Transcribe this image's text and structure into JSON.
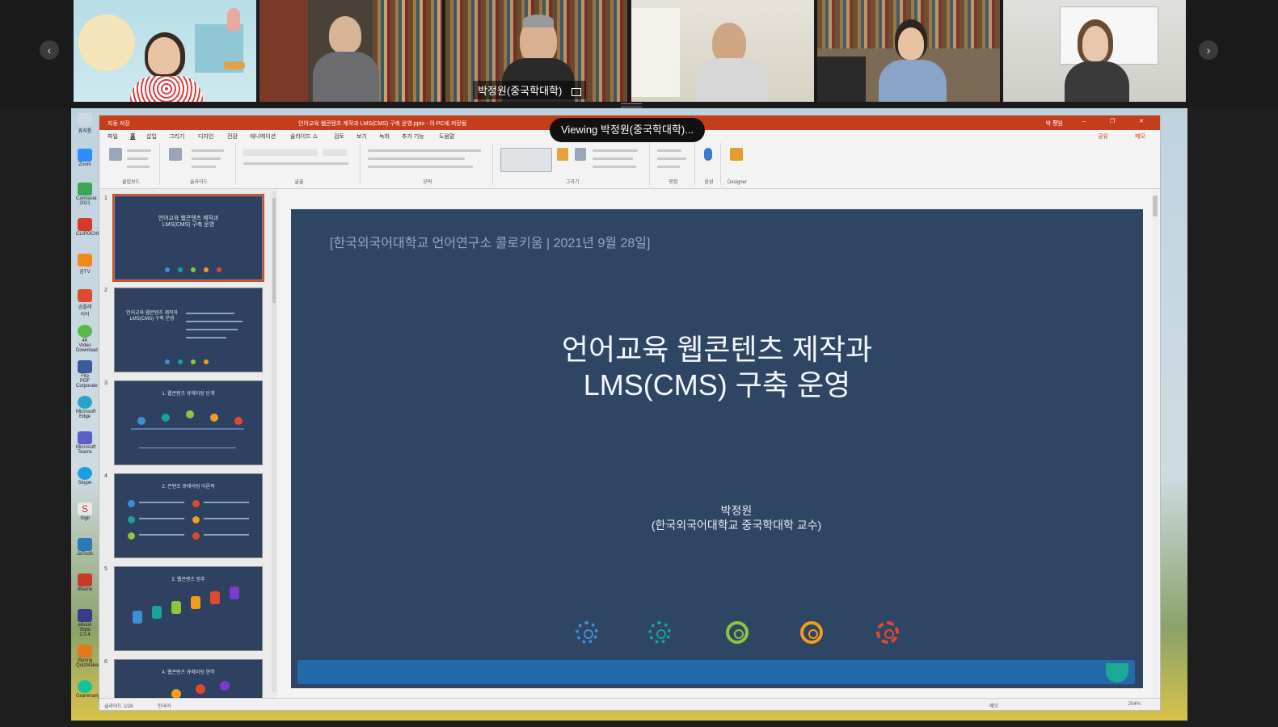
{
  "participants": [
    {
      "id": "p1"
    },
    {
      "id": "p2"
    },
    {
      "id": "p3",
      "name": "박정원(중국학대학)",
      "active": true
    },
    {
      "id": "p4"
    },
    {
      "id": "p5"
    },
    {
      "id": "p6"
    }
  ],
  "nav": {
    "prev_icon": "chevron-left-icon",
    "next_icon": "chevron-right-icon",
    "prev_glyph": "‹",
    "next_glyph": "›"
  },
  "share_icon": "share-screen-icon",
  "viewing_label": "Viewing 박정원(중국학대학)...",
  "ppt": {
    "window_title": "언어교육 웹콘텐츠 제작과 LMS(CMS) 구축 운영.pptx - 이 PC에 저장됨",
    "autosave": "자동 저장",
    "user": "박 정원",
    "menu": [
      "파일",
      "홈",
      "삽입",
      "그리기",
      "디자인",
      "전환",
      "애니메이션",
      "슬라이드 쇼",
      "검토",
      "보기",
      "녹화",
      "추가 기능",
      "도움말"
    ],
    "share_btn": "공유",
    "comment_btn": "메모",
    "ribbon_groups": [
      "클립보드",
      "슬라이드",
      "글꼴",
      "단락",
      "그리기",
      "편집",
      "음성",
      "Designer"
    ],
    "slide_count_label": "슬라이드 1/26",
    "language": "한국어",
    "notes_label": "메모",
    "zoom": "204%"
  },
  "thumbnails": [
    {
      "num": "1",
      "title": "언어교육 웹콘텐츠 제작과\nLMS(CMS) 구축 운영"
    },
    {
      "num": "2",
      "title": "언어교육 웹콘텐츠 제작과\nLMS(CMS) 구축 운영"
    },
    {
      "num": "3",
      "title": "1. 웹콘텐츠 큐레이팅 단계"
    },
    {
      "num": "4",
      "title": "2. 콘텐츠 큐레이팅 이론적"
    },
    {
      "num": "5",
      "title": "3. 웹콘텐츠 범주"
    },
    {
      "num": "6",
      "title": "4. 웹콘텐츠 큐레이팅 현역"
    }
  ],
  "slide": {
    "meta": "[한국외국어대학교 언어연구소 콜로키움 | 2021년 9월 28일]",
    "title_line1": "언어교육 웹콘텐츠 제작과",
    "title_line2": "LMS(CMS) 구축 운영",
    "author_name": "박정원",
    "author_affil": "(한국외국어대학교 중국학대학 교수)",
    "rings": [
      {
        "color": "#3e8ed3",
        "icon": "settings-icon"
      },
      {
        "color": "#19a39a",
        "icon": "compass-icon"
      },
      {
        "color": "#8cc63e",
        "icon": "camera-icon"
      },
      {
        "color": "#f39c1d",
        "icon": "edit-icon"
      },
      {
        "color": "#e04a2c",
        "icon": "video-icon"
      }
    ]
  },
  "desktop_icons": [
    "휴지통",
    "Zoom",
    "Camtasia 2021",
    "CLIPOCHI",
    "곰TV",
    "곰플레이어",
    "4K Video Download",
    "Flip PDF Corporate",
    "Microsoft Edge",
    "Microsoft Teams",
    "Skype",
    "Sigil",
    "JaTools",
    "iBlame",
    "eBook Style 2.0.4",
    "iSpring QuizMaker",
    "Grammarly"
  ]
}
